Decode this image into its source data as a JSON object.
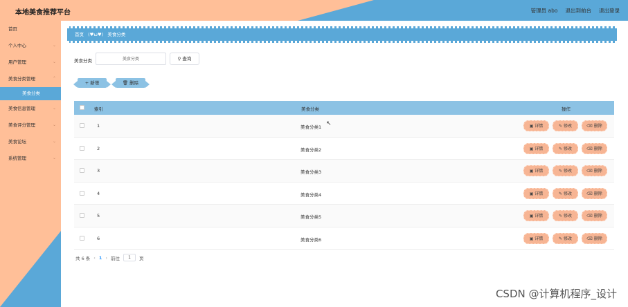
{
  "header": {
    "title": "本地美食推荐平台",
    "admin_label": "管理员 abo",
    "back_label": "退出到前台",
    "logout_label": "退出登录"
  },
  "sidebar": {
    "items": [
      {
        "label": "首页"
      },
      {
        "label": "个人中心"
      },
      {
        "label": "用户管理"
      },
      {
        "label": "美食分类管理"
      }
    ],
    "active_sub": "美食分类",
    "items_after": [
      {
        "label": "美食信息管理"
      },
      {
        "label": "美食评分管理"
      },
      {
        "label": "美食论坛"
      },
      {
        "label": "系统管理"
      }
    ]
  },
  "breadcrumb": {
    "home": "首页",
    "separator": "(♥ω♥)",
    "current": "美食分类"
  },
  "search": {
    "label": "美食分类",
    "placeholder": "美食分类",
    "button_label": "查询"
  },
  "actions": {
    "add_label": "新增",
    "delete_label": "删除"
  },
  "table": {
    "columns": [
      "索引",
      "美食分类",
      "操作"
    ],
    "rows": [
      {
        "index": "1",
        "category": "美食分类1"
      },
      {
        "index": "2",
        "category": "美食分类2"
      },
      {
        "index": "3",
        "category": "美食分类3"
      },
      {
        "index": "4",
        "category": "美食分类4"
      },
      {
        "index": "5",
        "category": "美食分类5"
      },
      {
        "index": "6",
        "category": "美食分类6"
      }
    ],
    "op_detail": "详情",
    "op_edit": "修改",
    "op_delete": "删除"
  },
  "pager": {
    "total": "共 6 条",
    "current_page": "1",
    "goto_label": "前往",
    "goto_value": "1",
    "page_suffix": "页"
  },
  "watermark": "CSDN @计算机程序_设计",
  "colors": {
    "peach": "#ffbf98",
    "blue": "#5aa8d8",
    "light_blue": "#8cc2e4",
    "op_button": "#f7b594"
  }
}
